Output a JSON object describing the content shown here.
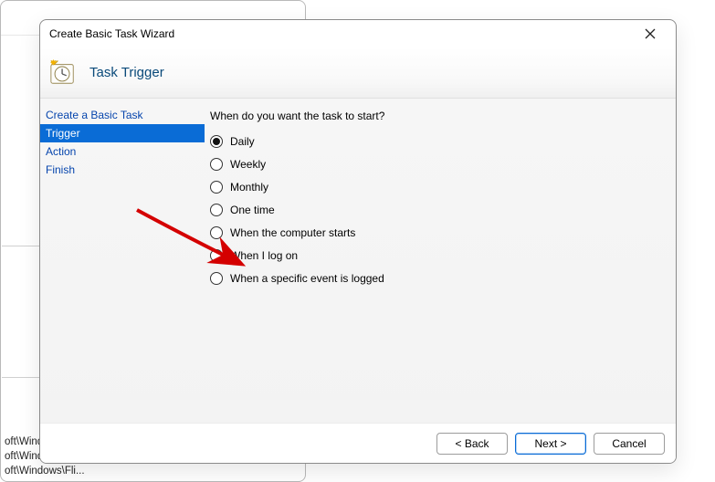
{
  "dialog": {
    "title": "Create Basic Task Wizard",
    "heading": "Task Trigger"
  },
  "steps": [
    {
      "label": "Create a Basic Task",
      "selected": false
    },
    {
      "label": "Trigger",
      "selected": true
    },
    {
      "label": "Action",
      "selected": false
    },
    {
      "label": "Finish",
      "selected": false
    }
  ],
  "question": "When do you want the task to start?",
  "options": [
    {
      "label": "Daily",
      "checked": true
    },
    {
      "label": "Weekly",
      "checked": false
    },
    {
      "label": "Monthly",
      "checked": false
    },
    {
      "label": "One time",
      "checked": false
    },
    {
      "label": "When the computer starts",
      "checked": false
    },
    {
      "label": "When I log on",
      "checked": false
    },
    {
      "label": "When a specific event is logged",
      "checked": false
    }
  ],
  "buttons": {
    "back": "< Back",
    "next": "Next >",
    "cancel": "Cancel"
  },
  "bg_list": [
    "oft\\Windo...",
    "oft\\Windows\\O...",
    "oft\\Windows\\Fli..."
  ]
}
